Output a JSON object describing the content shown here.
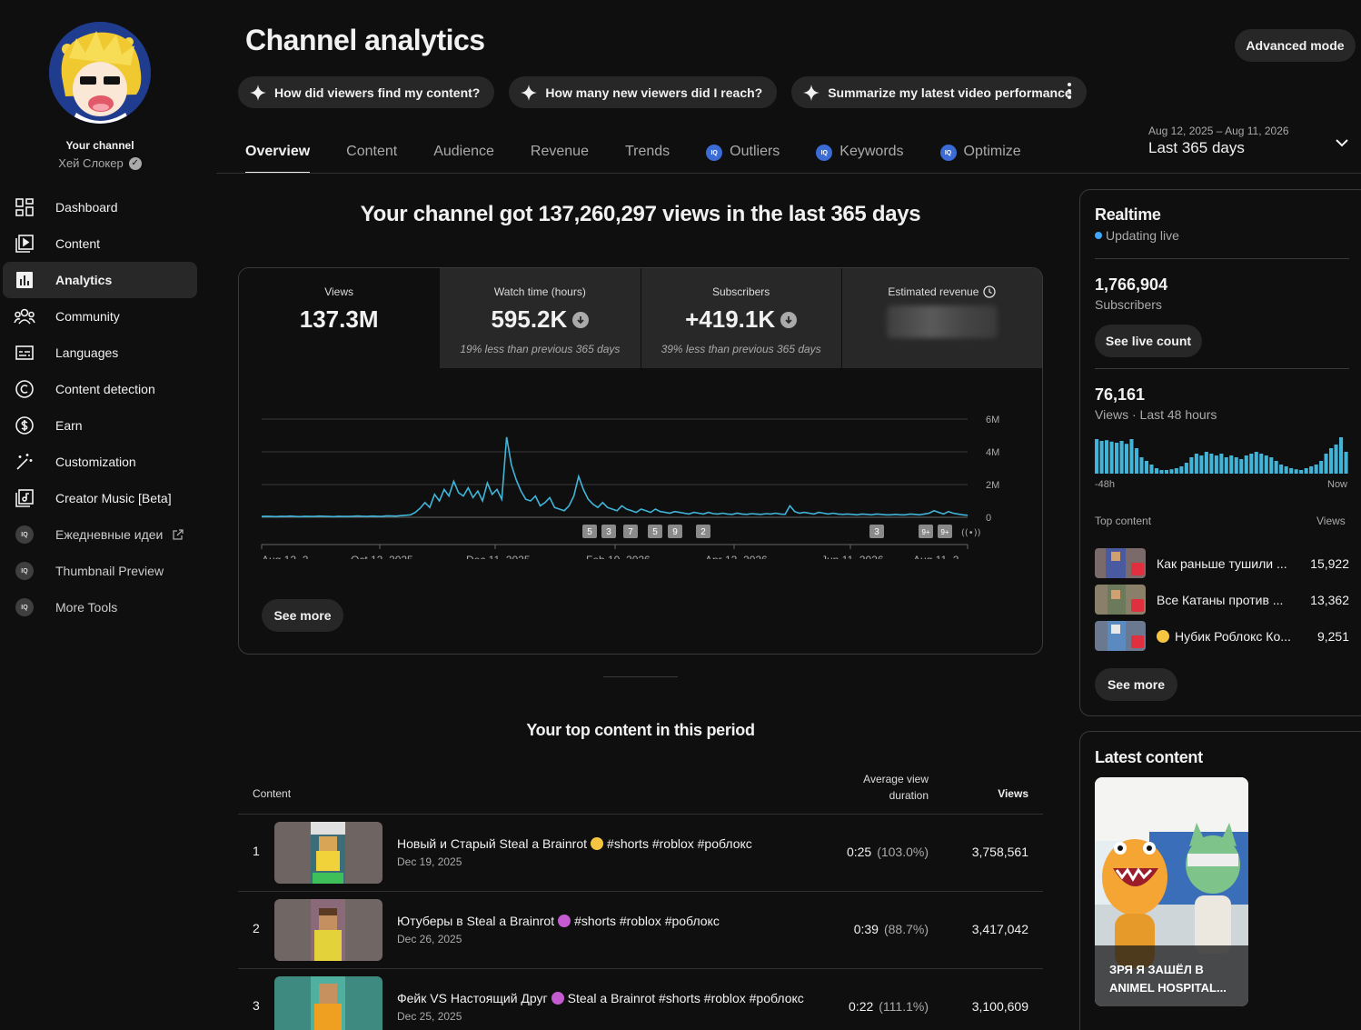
{
  "sidebar": {
    "your_channel": "Your channel",
    "channel_name": "Хей Слокер",
    "items": [
      {
        "label": "Dashboard",
        "icon": "dashboard-icon"
      },
      {
        "label": "Content",
        "icon": "content-icon"
      },
      {
        "label": "Analytics",
        "icon": "analytics-icon",
        "active": true
      },
      {
        "label": "Community",
        "icon": "community-icon"
      },
      {
        "label": "Languages",
        "icon": "subtitles-icon"
      },
      {
        "label": "Content detection",
        "icon": "copyright-icon"
      },
      {
        "label": "Earn",
        "icon": "dollar-icon"
      },
      {
        "label": "Customization",
        "icon": "magic-wand-icon"
      },
      {
        "label": "Creator Music [Beta]",
        "icon": "music-icon"
      },
      {
        "label": "Ежедневные идеи",
        "icon": "iq-icon"
      },
      {
        "label": "Thumbnail Preview",
        "icon": "iq-icon"
      },
      {
        "label": "More Tools",
        "icon": "iq-icon"
      }
    ]
  },
  "header": {
    "title": "Channel analytics",
    "advanced_mode": "Advanced mode",
    "chips": [
      "How did viewers find my content?",
      "How many new viewers did I reach?",
      "Summarize my latest video performance"
    ],
    "tabs": [
      {
        "label": "Overview",
        "active": true,
        "iq": false
      },
      {
        "label": "Content",
        "iq": false
      },
      {
        "label": "Audience",
        "iq": false
      },
      {
        "label": "Revenue",
        "iq": false
      },
      {
        "label": "Trends",
        "iq": false
      },
      {
        "label": "Outliers",
        "iq": true
      },
      {
        "label": "Keywords",
        "iq": true
      },
      {
        "label": "Optimize",
        "iq": true
      }
    ],
    "date_range": "Aug 12, 2025 – Aug 11, 2026",
    "date_label": "Last 365 days"
  },
  "overview": {
    "headline": "Your channel got 137,260,297 views in the last 365 days",
    "metrics": [
      {
        "label": "Views",
        "value": "137.3M",
        "note": ""
      },
      {
        "label": "Watch time (hours)",
        "value": "595.2K",
        "note": "19% less than previous 365 days"
      },
      {
        "label": "Subscribers",
        "value": "+419.1K",
        "note": "39% less than previous 365 days"
      },
      {
        "label": "Estimated revenue",
        "value": "",
        "note": ""
      }
    ],
    "see_more": "See more"
  },
  "chart_data": {
    "type": "line",
    "series": [
      {
        "name": "Views",
        "color": "#41b4d8",
        "values": [
          0.05,
          0.06,
          0.05,
          0.04,
          0.06,
          0.05,
          0.07,
          0.05,
          0.04,
          0.06,
          0.05,
          0.05,
          0.07,
          0.06,
          0.05,
          0.04,
          0.06,
          0.05,
          0.05,
          0.06,
          0.08,
          0.06,
          0.05,
          0.07,
          0.06,
          0.05,
          0.09,
          0.08,
          0.07,
          0.1,
          0.12,
          0.15,
          0.3,
          0.55,
          0.9,
          0.6,
          1.4,
          1.0,
          1.7,
          1.3,
          2.2,
          1.5,
          1.3,
          1.8,
          1.2,
          1.6,
          1.0,
          2.1,
          1.4,
          1.7,
          1.1,
          4.9,
          3.2,
          2.3,
          1.6,
          1.1,
          1.0,
          1.3,
          0.7,
          0.9,
          1.2,
          0.6,
          0.5,
          0.4,
          0.7,
          1.3,
          2.5,
          1.7,
          1.1,
          0.8,
          0.6,
          0.9,
          0.6,
          0.5,
          0.4,
          0.7,
          0.5,
          0.4,
          0.3,
          0.5,
          0.4,
          0.3,
          0.5,
          0.35,
          0.3,
          0.25,
          0.35,
          0.3,
          0.25,
          0.2,
          0.3,
          0.25,
          0.2,
          0.3,
          0.22,
          0.2,
          0.25,
          0.2,
          0.18,
          0.25,
          0.2,
          0.18,
          0.22,
          0.2,
          0.18,
          0.22,
          0.2,
          0.25,
          0.2,
          0.18,
          0.7,
          0.35,
          0.25,
          0.3,
          0.25,
          0.2,
          0.3,
          0.25,
          0.2,
          0.25,
          0.2,
          0.18,
          0.2,
          0.18,
          0.15,
          0.2,
          0.18,
          0.15,
          0.2,
          0.18,
          0.15,
          0.15,
          0.18,
          0.15,
          0.15,
          0.2,
          0.18,
          0.15,
          0.2,
          0.25,
          0.4,
          0.3,
          0.2,
          0.35,
          0.25,
          0.2,
          0.15,
          0.12
        ]
      }
    ],
    "x_ticks": [
      "Aug 12, 2...",
      "Oct 12, 2025",
      "Dec 11, 2025",
      "Feb 10, 2026",
      "Apr 12, 2026",
      "Jun 11, 2026",
      "Aug 11, 2..."
    ],
    "y_ticks": [
      "0",
      "2M",
      "4M",
      "6M"
    ],
    "ylim": [
      0,
      6000000
    ],
    "markers": [
      "5",
      "3",
      "7",
      "5",
      "9",
      "2",
      "3",
      "9+",
      "9+"
    ]
  },
  "top_content": {
    "title": "Your top content in this period",
    "col_content": "Content",
    "col_avd_line1": "Average view",
    "col_avd_line2": "duration",
    "col_views": "Views",
    "rows": [
      {
        "num": "1",
        "title_a": "Новый и Старый Steal a Brainrot",
        "title_b": "#shorts #roblox #роблокс",
        "date": "Dec 19, 2025",
        "avd": "0:25",
        "pct": "(103.0%)",
        "views": "3,758,561"
      },
      {
        "num": "2",
        "title_a": "Ютуберы в Steal a Brainrot",
        "title_b": "#shorts #roblox #роблокс",
        "date": "Dec 26, 2025",
        "avd": "0:39",
        "pct": "(88.7%)",
        "views": "3,417,042"
      },
      {
        "num": "3",
        "title_a": "Фейк VS Настоящий Друг",
        "title_b": "Steal a Brainrot #shorts #roblox #роблокс",
        "date": "Dec 25, 2025",
        "avd": "0:22",
        "pct": "(111.1%)",
        "views": "3,100,609"
      }
    ]
  },
  "realtime": {
    "title": "Realtime",
    "updating": "Updating live",
    "subs_value": "1,766,904",
    "subs_label": "Subscribers",
    "see_live": "See live count",
    "views_value": "76,161",
    "views_label": "Views · Last 48 hours",
    "axis_left": "-48h",
    "axis_right": "Now",
    "bars": [
      0.95,
      0.9,
      0.92,
      0.88,
      0.85,
      0.9,
      0.82,
      0.95,
      0.7,
      0.45,
      0.35,
      0.25,
      0.15,
      0.1,
      0.1,
      0.12,
      0.15,
      0.2,
      0.3,
      0.45,
      0.55,
      0.5,
      0.6,
      0.55,
      0.5,
      0.55,
      0.45,
      0.5,
      0.45,
      0.4,
      0.5,
      0.55,
      0.6,
      0.55,
      0.5,
      0.45,
      0.35,
      0.25,
      0.2,
      0.15,
      0.12,
      0.1,
      0.15,
      0.2,
      0.25,
      0.35,
      0.55,
      0.7,
      0.8,
      1.0,
      0.6
    ],
    "top_head": "Top content",
    "top_views": "Views",
    "top": [
      {
        "title": "Как раньше тушили ...",
        "views": "15,922"
      },
      {
        "title": "Все Катаны против ...",
        "views": "13,362"
      },
      {
        "title": "Нубик Роблокс Ко...",
        "views": "9,251"
      }
    ],
    "see_more": "See more"
  },
  "latest": {
    "title": "Latest content",
    "caption": "ЗРЯ Я ЗАШЁЛ В ANIMEL HOSPITAL..."
  }
}
